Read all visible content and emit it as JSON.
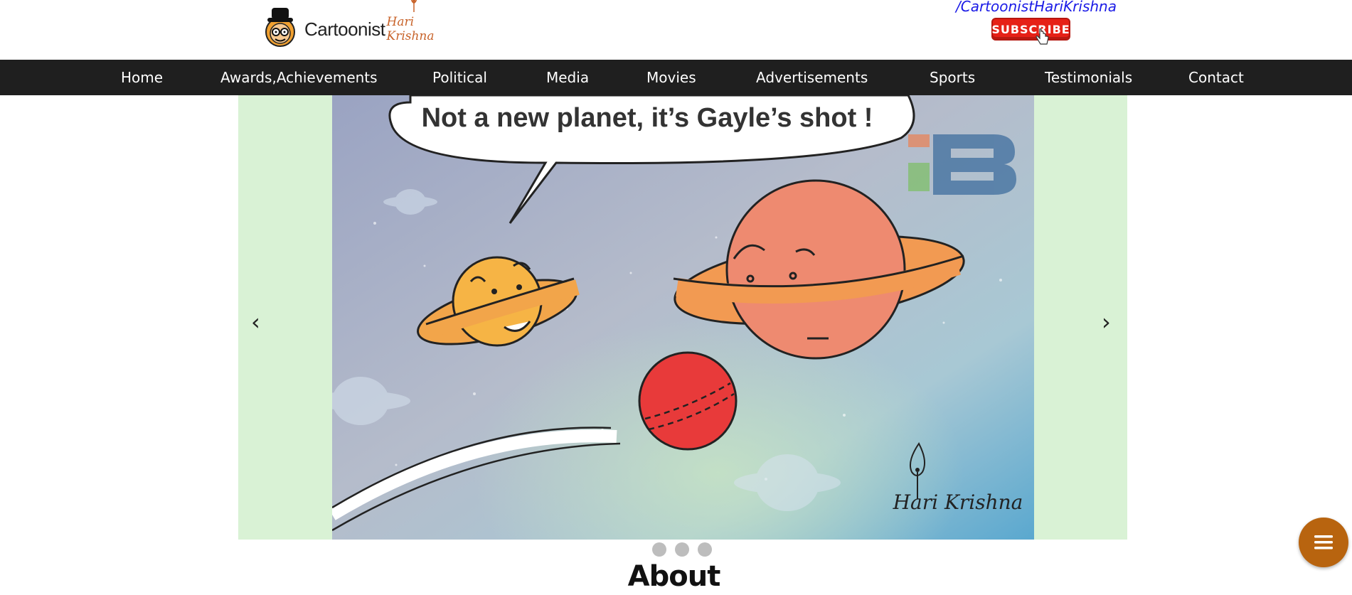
{
  "header": {
    "logo_text": "Cartoonist",
    "logo_script": "Hari Krishna",
    "channel_link": "/CartoonistHariKrishna",
    "subscribe_label": "SUBSCRIBE"
  },
  "nav": {
    "items": [
      {
        "label": "Home"
      },
      {
        "label": "Awards,Achievements"
      },
      {
        "label": "Political"
      },
      {
        "label": "Media"
      },
      {
        "label": "Movies"
      },
      {
        "label": "Advertisements"
      },
      {
        "label": "Sports"
      },
      {
        "label": "Testimonials"
      },
      {
        "label": "Contact"
      }
    ]
  },
  "slider": {
    "prev_label": "‹",
    "next_label": "›",
    "slide": {
      "caption": "Not a new planet, it’s Gayle’s shot !",
      "signature": "Hari Krishna"
    },
    "dot_count": 3
  },
  "about": {
    "heading": "About"
  },
  "colors": {
    "nav_bg": "#1f1f1f",
    "slider_bg": "#d9f2d5",
    "subscribe_bg": "#e62117",
    "channel_link": "#1a1ae6",
    "fab_bg": "#b8640f"
  },
  "icons": {
    "fab": "menu-icon",
    "cursor": "hand-cursor-icon"
  }
}
